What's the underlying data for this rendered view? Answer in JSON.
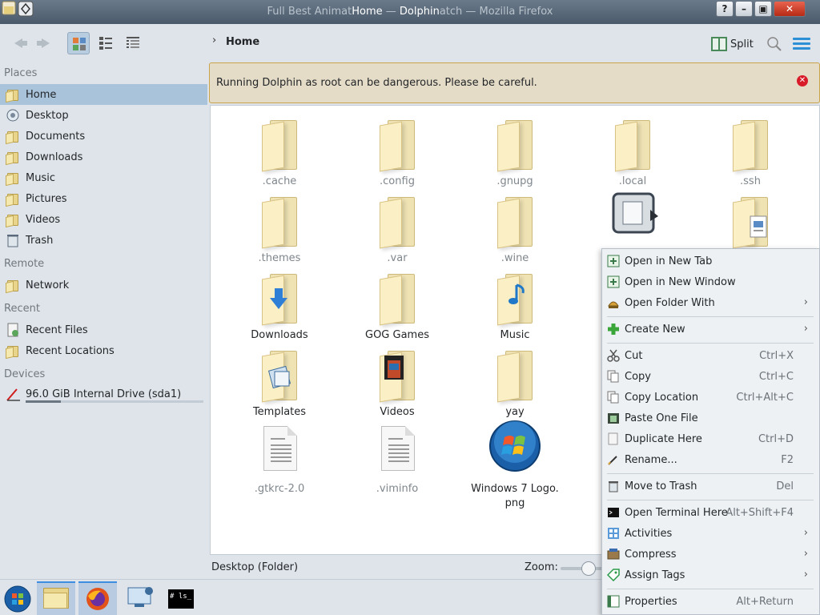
{
  "window": {
    "title_part1": "Full Best Animat",
    "title_part2": "Home",
    "title_part3": " — ",
    "title_part4": "Dolphin",
    "title_part5": "atch — Mozilla Firefox"
  },
  "toolbar": {
    "breadcrumb_sep": "›",
    "breadcrumb_home": "Home",
    "split_label": "Split"
  },
  "warning": {
    "message": "Running Dolphin as root can be dangerous. Please be careful."
  },
  "sidebar": {
    "places_header": "Places",
    "places": [
      {
        "label": "Home"
      },
      {
        "label": "Desktop"
      },
      {
        "label": "Documents"
      },
      {
        "label": "Downloads"
      },
      {
        "label": "Music"
      },
      {
        "label": "Pictures"
      },
      {
        "label": "Videos"
      },
      {
        "label": "Trash"
      }
    ],
    "remote_header": "Remote",
    "remote": [
      {
        "label": "Network"
      }
    ],
    "recent_header": "Recent",
    "recent": [
      {
        "label": "Recent Files"
      },
      {
        "label": "Recent Locations"
      }
    ],
    "devices_header": "Devices",
    "devices": [
      {
        "label": "96.0 GiB Internal Drive (sda1)"
      }
    ]
  },
  "files": [
    {
      "name": ".cache"
    },
    {
      "name": ".config"
    },
    {
      "name": ".gnupg"
    },
    {
      "name": ".local"
    },
    {
      "name": ".ssh"
    },
    {
      "name": ".themes"
    },
    {
      "name": ".var"
    },
    {
      "name": ".wine"
    },
    {
      "name": "Downloads"
    },
    {
      "name": "GOG Games"
    },
    {
      "name": "Music"
    },
    {
      "name": "Templates"
    },
    {
      "name": "Videos"
    },
    {
      "name": "yay"
    },
    {
      "name": ".gtkrc-2.0"
    },
    {
      "name": ".viminfo"
    },
    {
      "name": "Windows 7 Logo.",
      "name2": "png"
    }
  ],
  "statusbar": {
    "text": "Desktop (Folder)",
    "zoom_label": "Zoom:"
  },
  "context_menu": {
    "items": [
      {
        "label": "Open in New Tab",
        "key": ""
      },
      {
        "label": "Open in New Window",
        "key": ""
      },
      {
        "label": "Open Folder With",
        "key": ""
      },
      {
        "label": "Create New",
        "key": ""
      },
      {
        "label": "Cut",
        "key": "Ctrl+X"
      },
      {
        "label": "Copy",
        "key": "Ctrl+C"
      },
      {
        "label": "Copy Location",
        "key": "Ctrl+Alt+C"
      },
      {
        "label": "Paste One File",
        "key": ""
      },
      {
        "label": "Duplicate Here",
        "key": "Ctrl+D"
      },
      {
        "label": "Rename...",
        "key": "F2"
      },
      {
        "label": "Move to Trash",
        "key": "Del"
      },
      {
        "label": "Open Terminal Here",
        "key": "Alt+Shift+F4"
      },
      {
        "label": "Activities",
        "key": ""
      },
      {
        "label": "Compress",
        "key": ""
      },
      {
        "label": "Assign Tags",
        "key": ""
      },
      {
        "label": "Properties",
        "key": "Alt+Return"
      }
    ],
    "submenu_arrow": "›"
  },
  "taskbar": {
    "terminal_text": "# ls_"
  },
  "colors": {
    "accent": "#2d8fd5",
    "selection": "#a8c3da",
    "warning_bg": "#e5dcc7",
    "warning_border": "#c9a44a",
    "close_red": "#d81c2a"
  }
}
